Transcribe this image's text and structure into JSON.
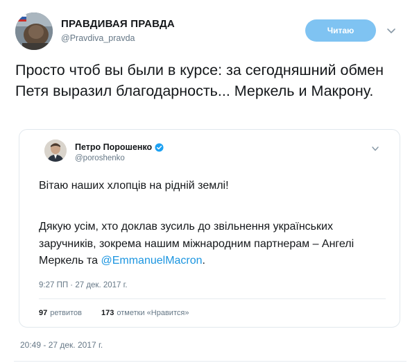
{
  "tweet": {
    "author_name": "ПРАВДИВАЯ ПРАВДА",
    "author_handle": "@Pravdiva_pravda",
    "follow_label": "Читаю",
    "text": "Просто чтоб вы были в курсе: за сегодняшний обмен Петя выразил благодарность... Меркель и Макрону.",
    "timestamp": "20:49 - 27 дек. 2017 г."
  },
  "quoted": {
    "author_name": "Петро Порошенко",
    "author_handle": "@poroshenko",
    "line1": "Вітаю наших хлопців на рідній землі!",
    "para2_text": "Дякую усім, хто доклав зусиль до звільнення українських заручників, зокрема нашим міжнародним партнерам – Ангелі Меркель та ",
    "mention": "@EmmanuelMacron",
    "para2_end": ".",
    "timestamp": "9:27 ПП · 27 дек. 2017 г.",
    "retweets_count": "97",
    "retweets_label": "ретвитов",
    "likes_count": "173",
    "likes_label": "отметки «Нравится»"
  },
  "colors": {
    "follow_button": "#7fc3f2",
    "mention": "#1b95e0",
    "verified": "#1da1f2",
    "secondary_text": "#657786"
  }
}
